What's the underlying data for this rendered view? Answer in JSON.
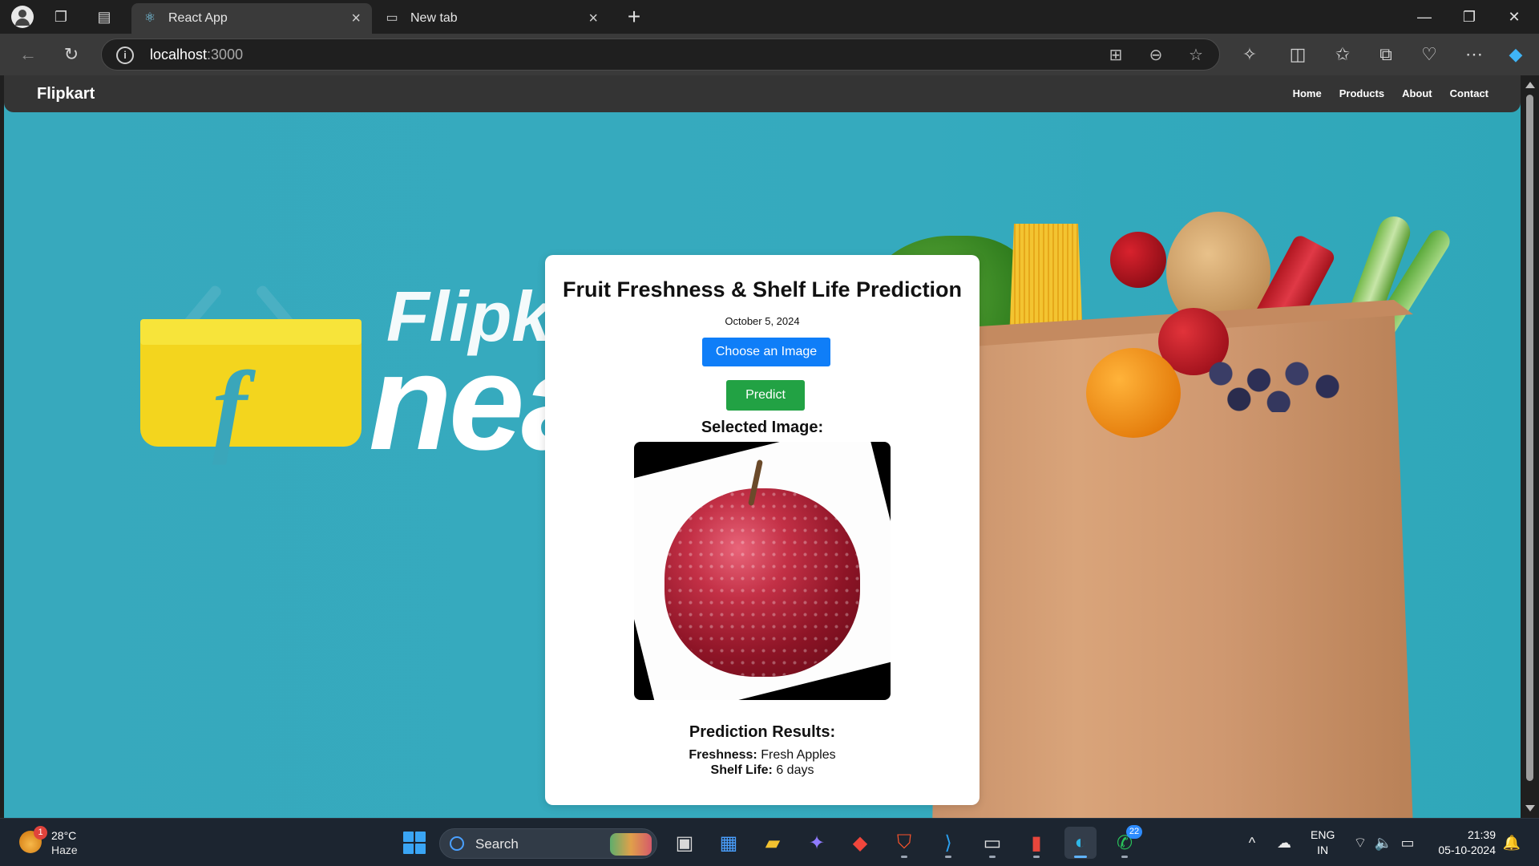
{
  "browser": {
    "tabs": [
      {
        "title": "React App",
        "active": true,
        "icon": "react-icon"
      },
      {
        "title": "New tab",
        "active": false,
        "icon": "newtab-page-icon"
      }
    ],
    "url_host": "localhost",
    "url_port": ":3000",
    "window_controls": [
      "minimize",
      "restore",
      "close"
    ]
  },
  "app": {
    "brand": "Flipkart",
    "nav": [
      "Home",
      "Products",
      "About",
      "Contact"
    ],
    "hero": {
      "line1": "Flipkart",
      "line2": "near"
    }
  },
  "card": {
    "title": "Fruit Freshness & Shelf Life Prediction",
    "date": "October 5, 2024",
    "choose_label": "Choose an Image",
    "predict_label": "Predict",
    "selected_heading": "Selected Image:",
    "selected_image": "red-apple-photo",
    "results_heading": "Prediction Results:",
    "freshness_label": "Freshness:",
    "freshness_value": "Fresh Apples",
    "shelf_label": "Shelf Life:",
    "shelf_value": "6 days"
  },
  "colors": {
    "choose_button": "#0f7ef8",
    "predict_button": "#22a244",
    "page_background": "#37a9bd",
    "navbar": "#343434"
  },
  "taskbar": {
    "weather": {
      "temp": "28°C",
      "condition": "Haze",
      "alert_count": "1"
    },
    "search_label": "Search",
    "whatsapp_badge": "22",
    "lang_line1": "ENG",
    "lang_line2": "IN",
    "time": "21:39",
    "date": "05-10-2024"
  }
}
